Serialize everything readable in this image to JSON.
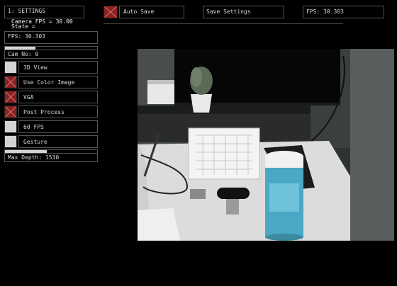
{
  "panel": {
    "title": "1: SETTINGS",
    "fps": "FPS: 30.303",
    "cam_no": "Cam No: 0",
    "fps_bar_fraction": 0.33,
    "items": [
      {
        "label": "3D View",
        "on": false
      },
      {
        "label": "Use Color Image",
        "on": true
      },
      {
        "label": "VGA",
        "on": true
      },
      {
        "label": "Post Process",
        "on": true
      },
      {
        "label": "60 FPS",
        "on": false
      },
      {
        "label": "Gesture",
        "on": false
      }
    ],
    "max_depth": "Max Depth: 1530",
    "max_depth_fraction": 0.45
  },
  "overlay": {
    "camera_fps": "Camera FPS = 30.00",
    "state": "State ="
  },
  "topbar": {
    "auto_save": "Auto Save",
    "auto_save_on": true,
    "save_settings": "Save Settings",
    "fps": "FPS: 30.303"
  },
  "colors": {
    "toggle_on": "#8e2020",
    "toggle_off": "#d4d4d4",
    "border": "#555555"
  }
}
